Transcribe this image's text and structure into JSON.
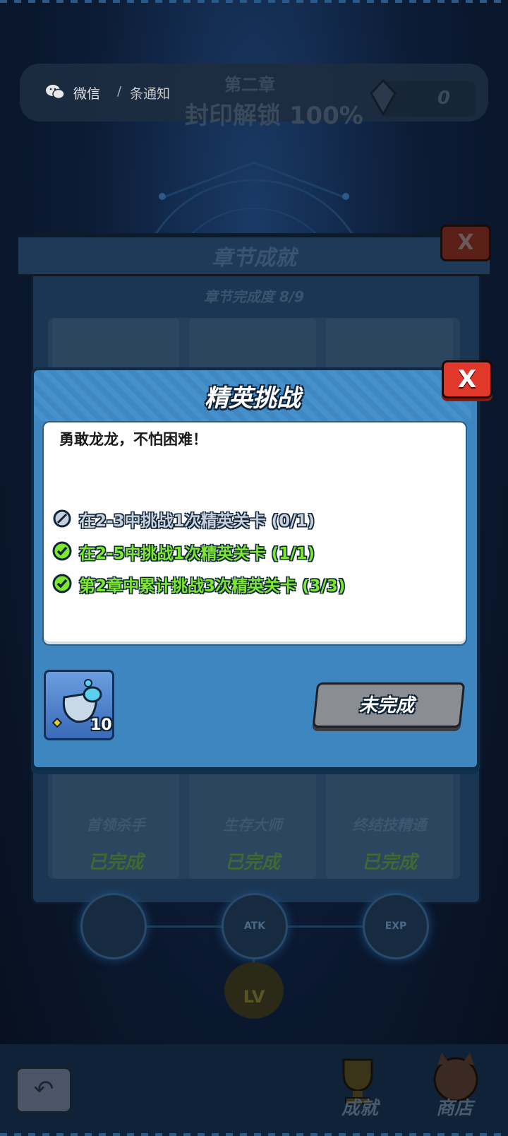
{
  "notification": {
    "app_name": "微信",
    "separator": "/",
    "message": "条通知"
  },
  "chapter": {
    "subtitle": "第二章",
    "unlock_progress": "封印解锁 100%",
    "gem_count": "0"
  },
  "achievements_panel": {
    "title": "章节成就",
    "progress": "章节完成度 8/9",
    "close_label": "X",
    "cards": [
      {
        "name": "首领杀手",
        "status": "已完成"
      },
      {
        "name": "生存大师",
        "status": "已完成"
      },
      {
        "name": "终结技精通",
        "status": "已完成"
      }
    ]
  },
  "skill_tree": {
    "nodes": [
      {
        "label": "",
        "icon": "horned-helmet-icon"
      },
      {
        "label": "ATK",
        "icon": "sword-icon"
      },
      {
        "label": "EXP",
        "icon": "exp-burst-icon"
      }
    ],
    "level_node": "LV"
  },
  "bottom_nav": {
    "back_icon": "back-arrow-icon",
    "achievements_label": "成就",
    "shop_label": "商店"
  },
  "modal": {
    "title": "精英挑战",
    "close_label": "X",
    "description": "勇敢龙龙，不怕困难！",
    "tasks": [
      {
        "text": "在2-3中挑战1次精英关卡 (0/1)",
        "status": "pending"
      },
      {
        "text": "在2-5中挑战1次精英关卡 (1/1)",
        "status": "done"
      },
      {
        "text": "第2章中累计挑战3次精英关卡 (3/3)",
        "status": "done"
      }
    ],
    "reward": {
      "icon": "potion-flask-icon",
      "count": "10"
    },
    "status_button": "未完成"
  },
  "colors": {
    "modal_bg": "#3e86bf",
    "done_green": "#7ee830",
    "close_red": "#e0382a",
    "pending_gray": "#8a8e92"
  }
}
